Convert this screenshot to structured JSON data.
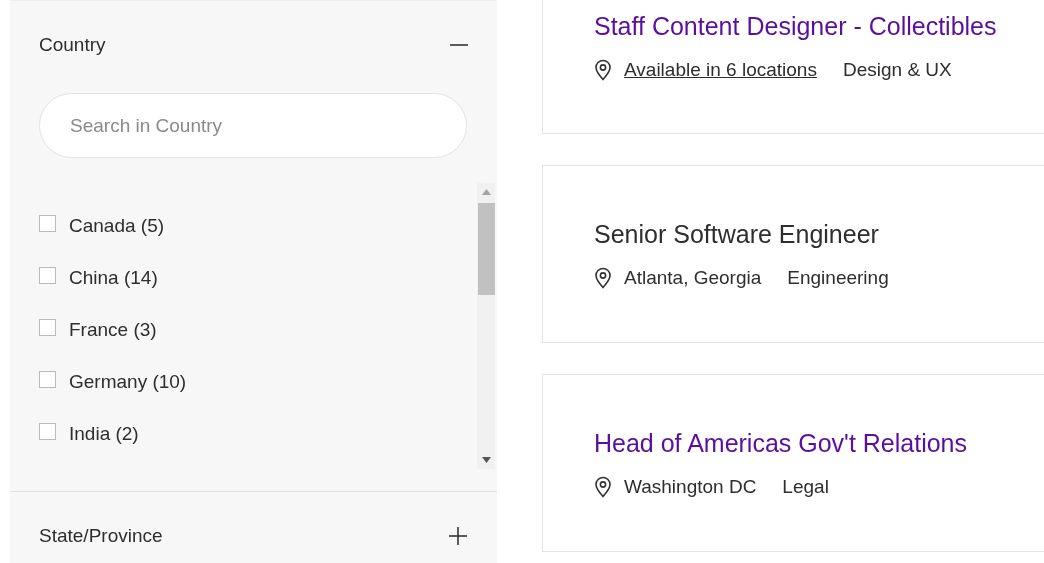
{
  "filters": [
    {
      "title": "Country",
      "expanded": true,
      "search": {
        "placeholder": "Search in Country"
      },
      "options": [
        {
          "label": "Canada (5)",
          "checked": false
        },
        {
          "label": "China (14)",
          "checked": false
        },
        {
          "label": "France (3)",
          "checked": false
        },
        {
          "label": "Germany (10)",
          "checked": false
        },
        {
          "label": "India (2)",
          "checked": false
        }
      ]
    },
    {
      "title": "State/Province",
      "expanded": false
    }
  ],
  "jobs": [
    {
      "title": "Staff Content Designer - Collectibles",
      "visited": true,
      "location": {
        "kind": "link",
        "text": "Available in 6 locations"
      },
      "category": "Design & UX"
    },
    {
      "title": "Senior Software Engineer",
      "visited": false,
      "location": {
        "kind": "text",
        "text": "Atlanta, Georgia"
      },
      "category": "Engineering"
    },
    {
      "title": "Head of Americas Gov't Relations",
      "visited": true,
      "location": {
        "kind": "text",
        "text": "Washington DC"
      },
      "category": "Legal"
    }
  ]
}
